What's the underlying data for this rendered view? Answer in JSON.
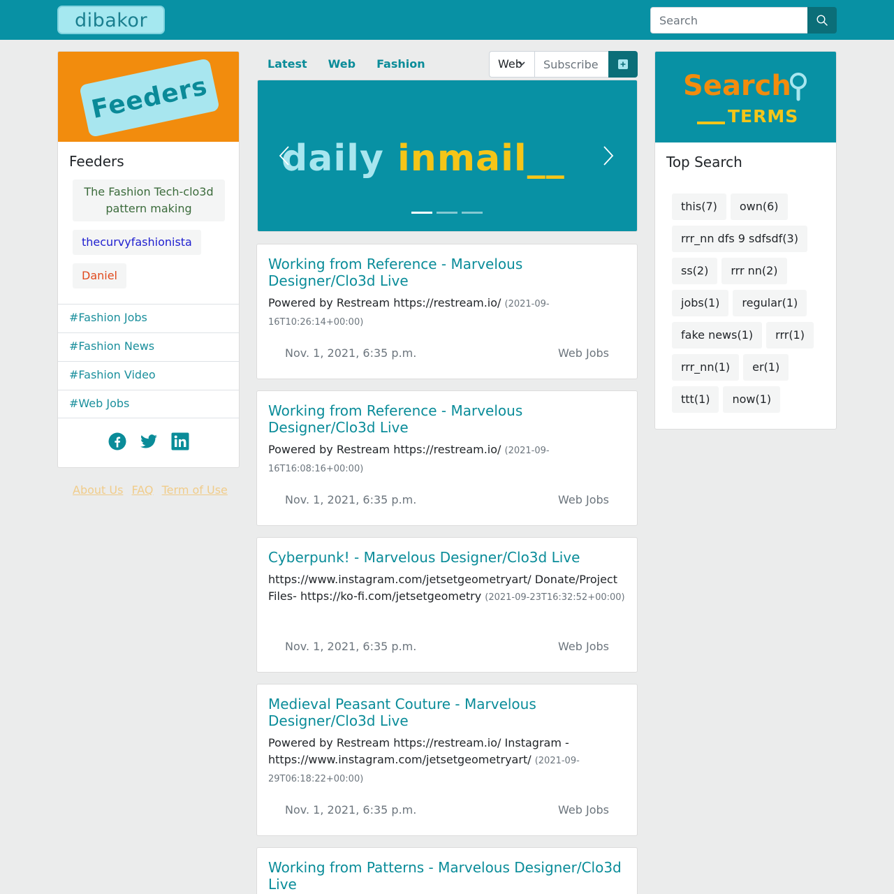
{
  "header": {
    "logo_text": "dibakor",
    "search_placeholder": "Search"
  },
  "left": {
    "banner_text": "Feeders",
    "title": "Feeders",
    "feeders": [
      "The Fashion Tech-clo3d pattern making",
      "thecurvyfashionista",
      "Daniel"
    ],
    "tags": [
      "#Fashion Jobs",
      "#Fashion News",
      "#Fashion Video",
      "#Web Jobs"
    ],
    "social_icons": [
      "facebook-icon",
      "twitter-icon",
      "linkedin-icon"
    ],
    "footer_links": [
      "About Us",
      "FAQ",
      "Term of Use"
    ]
  },
  "middle": {
    "tabs": [
      "Latest",
      "Web",
      "Fashion"
    ],
    "category_select_value": "Web",
    "subscribe_placeholder": "Subscribe Email",
    "carousel": {
      "word1": "daily",
      "word2": "inmail__",
      "slide_count": 3,
      "active_slide": 1
    },
    "posts": [
      {
        "title": "Working from Reference - Marvelous Designer/Clo3d Live",
        "description": "Powered by Restream https://restream.io/",
        "published": "(2021-09-16T10:26:14+00:00)",
        "date": "Nov. 1, 2021, 6:35 p.m.",
        "category": "Web Jobs"
      },
      {
        "title": "Working from Reference - Marvelous Designer/Clo3d Live",
        "description": "Powered by Restream https://restream.io/",
        "published": "(2021-09-16T16:08:16+00:00)",
        "date": "Nov. 1, 2021, 6:35 p.m.",
        "category": "Web Jobs"
      },
      {
        "title": "Cyberpunk! - Marvelous Designer/Clo3d Live",
        "description": "https://www.instagram.com/jetsetgeometryart/ Donate/Project Files- https://ko-fi.com/jetsetgeometry",
        "published": "(2021-09-23T16:32:52+00:00)",
        "date": "Nov. 1, 2021, 6:35 p.m.",
        "category": "Web Jobs"
      },
      {
        "title": "Medieval Peasant Couture - Marvelous Designer/Clo3d Live",
        "description": "Powered by Restream https://restream.io/ Instagram - https://www.instagram.com/jetsetgeometryart/",
        "published": "(2021-09-29T06:18:22+00:00)",
        "date": "Nov. 1, 2021, 6:35 p.m.",
        "category": "Web Jobs"
      },
      {
        "title": "Working from Patterns - Marvelous Designer/Clo3d Live"
      }
    ]
  },
  "right": {
    "banner_word1": "Search",
    "banner_word2": "TERMS",
    "title": "Top Search",
    "terms": [
      "this(7)",
      "own(6)",
      "rrr_nn dfs 9 sdfsdf(3)",
      "ss(2)",
      "rrr nn(2)",
      "jobs(1)",
      "regular(1)",
      "fake news(1)",
      "rrr(1)",
      "rrr_nn(1)",
      "er(1)",
      "ttt(1)",
      "now(1)"
    ]
  },
  "colors": {
    "brand_teal": "#0891a4",
    "dark_teal": "#0b6e78",
    "orange": "#f28c0d",
    "yellow": "#f5c518",
    "link_teal": "#0a8c99"
  }
}
